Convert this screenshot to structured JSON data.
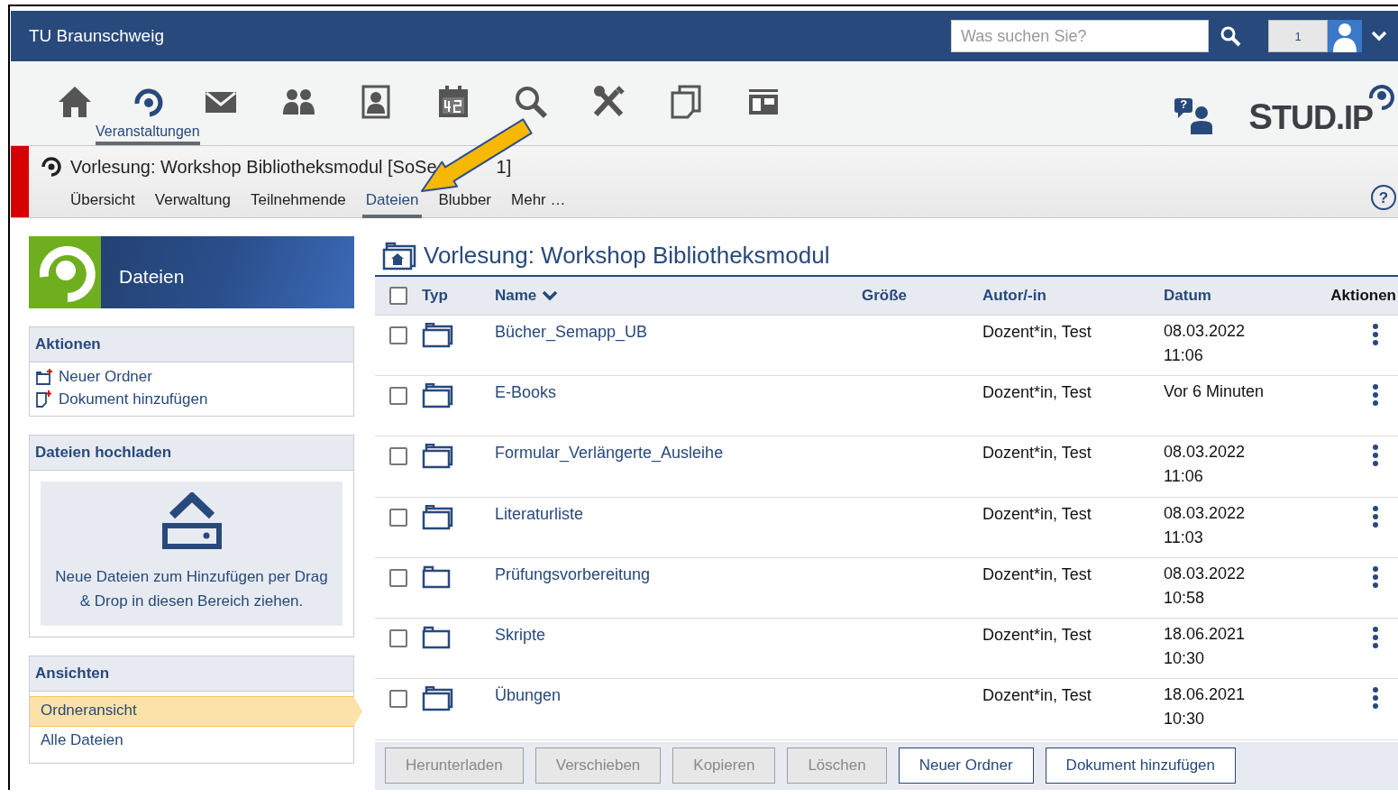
{
  "header": {
    "brand": "TU Braunschweig",
    "search": {
      "placeholder": "Was suchen Sie?"
    },
    "notification_count": "1"
  },
  "nav": {
    "items": [
      {
        "kind": "home",
        "selected": false
      },
      {
        "kind": "courses",
        "selected": true,
        "label": "Veranstaltungen"
      },
      {
        "kind": "mail",
        "selected": false
      },
      {
        "kind": "community",
        "selected": false
      },
      {
        "kind": "profile",
        "selected": false
      },
      {
        "kind": "calendar",
        "selected": false
      },
      {
        "kind": "search",
        "selected": false
      },
      {
        "kind": "tools",
        "selected": false
      },
      {
        "kind": "files",
        "selected": false
      },
      {
        "kind": "board",
        "selected": false
      }
    ],
    "help_glyph": "?",
    "logo": "STUD.IP"
  },
  "course": {
    "title": "Vorlesung: Workshop Bibliotheksmodul [SoSe",
    "title_tail": "1]",
    "help_glyph": "?",
    "tabs": [
      {
        "label": "Übersicht",
        "selected": false
      },
      {
        "label": "Verwaltung",
        "selected": false
      },
      {
        "label": "Teilnehmende",
        "selected": false
      },
      {
        "label": "Dateien",
        "selected": true
      },
      {
        "label": "Blubber",
        "selected": false
      },
      {
        "label": "Mehr …",
        "selected": false
      }
    ]
  },
  "sidebar": {
    "banner": "Dateien",
    "sections": [
      {
        "kind": "links",
        "title": "Aktionen",
        "items": [
          {
            "kind": "folder",
            "label": "Neuer Ordner"
          },
          {
            "kind": "document",
            "label": "Dokument hinzufügen"
          }
        ]
      },
      {
        "kind": "dropzone",
        "title": "Dateien hochladen",
        "text": "Neue Dateien zum Hinzufügen per Drag & Drop in diesen Bereich ziehen."
      },
      {
        "kind": "views",
        "title": "Ansichten",
        "items": [
          {
            "label": "Ordneransicht",
            "selected": true
          },
          {
            "label": "Alle Dateien",
            "selected": false
          }
        ]
      }
    ]
  },
  "files": {
    "title": "Vorlesung: Workshop Bibliotheksmodul",
    "select_all_checked": false,
    "columns": [
      "Typ",
      "Name",
      "Größe",
      "Autor/-in",
      "Datum",
      "Aktionen"
    ],
    "rows": [
      {
        "name": "Bücher_Semapp_UB",
        "author": "Dozent*in, Test",
        "date": "08.03.2022",
        "time": "11:06",
        "empty": false,
        "checked": false
      },
      {
        "name": "E-Books",
        "author": "Dozent*in, Test",
        "date": "Vor 6 Minuten",
        "empty": false,
        "checked": false
      },
      {
        "name": "Formular_Verlängerte_Ausleihe",
        "author": "Dozent*in, Test",
        "date": "08.03.2022",
        "time": "11:06",
        "empty": false,
        "checked": false
      },
      {
        "name": "Literaturliste",
        "author": "Dozent*in, Test",
        "date": "08.03.2022",
        "time": "11:03",
        "empty": false,
        "checked": false
      },
      {
        "name": "Prüfungsvorbereitung",
        "author": "Dozent*in, Test",
        "date": "08.03.2022",
        "time": "10:58",
        "empty": true,
        "checked": false
      },
      {
        "name": "Skripte",
        "author": "Dozent*in, Test",
        "date": "18.06.2021",
        "time": "10:30",
        "empty": true,
        "checked": false
      },
      {
        "name": "Übungen",
        "author": "Dozent*in, Test",
        "date": "18.06.2021",
        "time": "10:30",
        "empty": false,
        "checked": false
      }
    ],
    "buttons": [
      {
        "label": "Herunterladen",
        "disabled": true
      },
      {
        "label": "Verschieben",
        "disabled": true
      },
      {
        "label": "Kopieren",
        "disabled": true
      },
      {
        "label": "Löschen",
        "disabled": true
      },
      {
        "label": "Neuer Ordner",
        "disabled": false
      },
      {
        "label": "Dokument hinzufügen",
        "disabled": false
      }
    ]
  }
}
